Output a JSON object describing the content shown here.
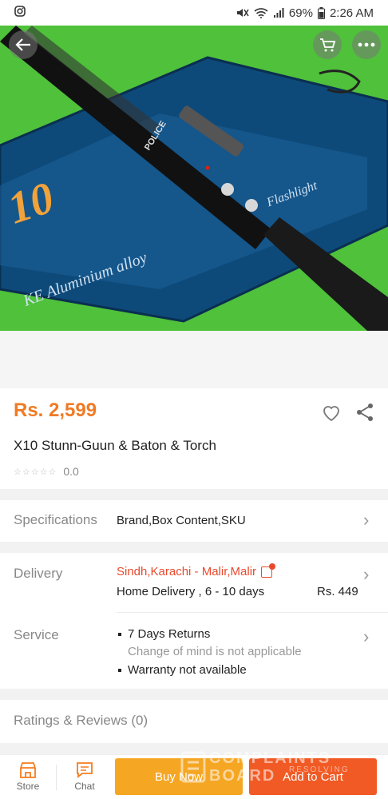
{
  "status_bar": {
    "battery": "69%",
    "time": "2:26 AM"
  },
  "product": {
    "price": "Rs. 2,599",
    "title": "X10 Stunn-Guun & Baton & Torch",
    "rating_value": "0.0",
    "stars": "☆☆☆☆☆"
  },
  "specifications": {
    "label": "Specifications",
    "value": "Brand,Box Content,SKU"
  },
  "delivery": {
    "label": "Delivery",
    "location": "Sindh,Karachi - Malir,Malir",
    "method": "Home Delivery , 6 - 10 days",
    "fee": "Rs. 449"
  },
  "service": {
    "label": "Service",
    "items": [
      {
        "text": "7 Days Returns",
        "sub": "Change of mind is not applicable"
      },
      {
        "text": "Warranty not available",
        "sub": ""
      }
    ]
  },
  "reviews": {
    "label": "Ratings & Reviews (0)"
  },
  "bottom_bar": {
    "store_label": "Store",
    "chat_label": "Chat",
    "buy_now_label": "Buy Now",
    "add_to_cart_label": "Add to Cart"
  },
  "hero_image": {
    "box_number": "10",
    "box_text_1": "KE Aluminium alloy",
    "box_text_2": "Flashlight",
    "baton_brand": "POLICE"
  },
  "watermark": {
    "line1": "COMPLAINTS",
    "line2": "BOARD",
    "line3": "RESOLVING"
  },
  "colors": {
    "price": "#f07a23",
    "location": "#e8492d",
    "buy_now": "#f5a623",
    "add_to_cart": "#f15a24"
  }
}
